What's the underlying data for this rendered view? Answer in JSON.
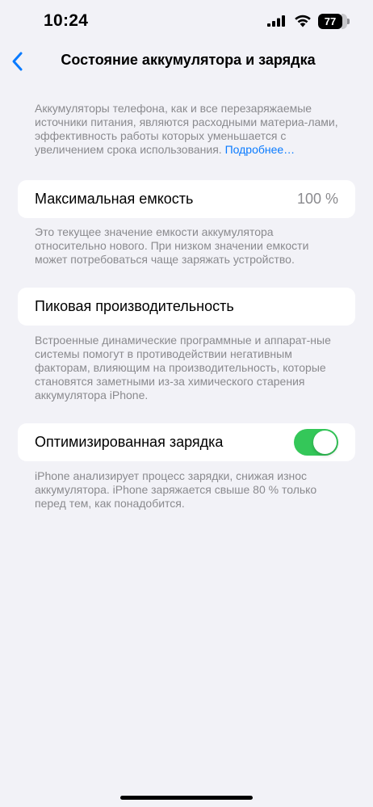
{
  "status_bar": {
    "time": "10:24",
    "battery_level": "77"
  },
  "nav": {
    "title": "Состояние аккумулятора и зарядка",
    "back_icon": "chevron-left-icon"
  },
  "intro": {
    "text": "Аккумуляторы телефона, как и все перезаряжаемые источники питания, являются расходными материа-лами, эффективность работы которых уменьшается с увеличением срока использования. ",
    "link": "Подробнее…"
  },
  "max_capacity": {
    "label": "Максимальная емкость",
    "value": "100 %",
    "footer": "Это текущее значение емкости аккумулятора относительно нового. При низком значении емкости может потребоваться чаще заряжать устройство."
  },
  "peak_performance": {
    "label": "Пиковая производительность",
    "footer": "Встроенные динамические программные и аппарат-ные системы помогут в противодействии негативным факторам, влияющим на производительность, которые становятся заметными из-за химического старения аккумулятора iPhone."
  },
  "optimized_charging": {
    "label": "Оптимизированная зарядка",
    "enabled": true,
    "footer": "iPhone анализирует процесс зарядки, снижая износ аккумулятора. iPhone заряжается свыше 80 % только перед тем, как понадобится."
  },
  "colors": {
    "background": "#f2f2f7",
    "accent": "#0a7bff",
    "toggle_on": "#34c759",
    "secondary_text": "#8a8a8e"
  }
}
